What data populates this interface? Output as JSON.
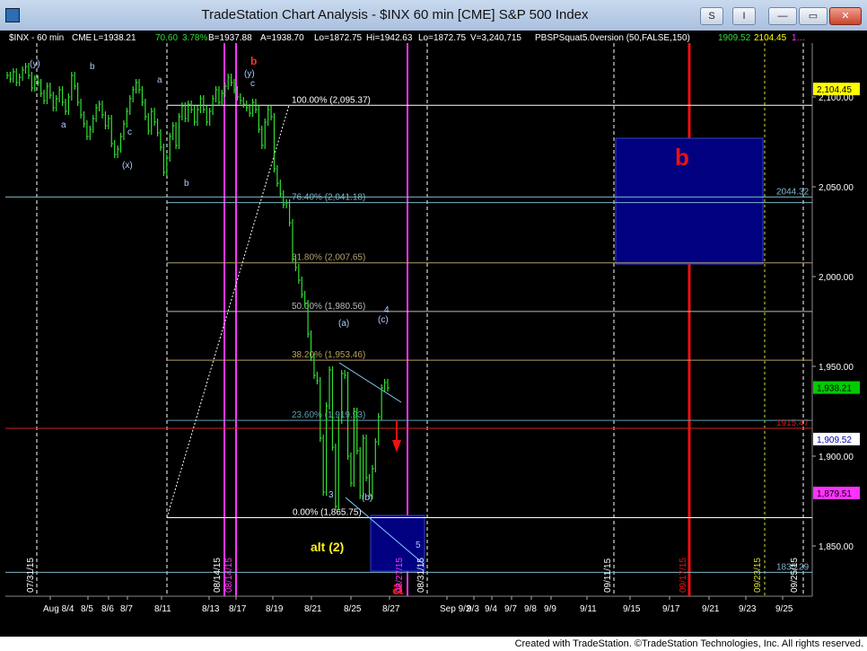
{
  "window": {
    "title": "TradeStation Chart Analysis - $INX 60 min [CME] S&P 500 Index",
    "buttons": {
      "s": "S",
      "indicator": "I",
      "minimize": "—",
      "maximize": "▭",
      "close": "✕"
    }
  },
  "chart_data": {
    "type": "line",
    "header": {
      "symbol": "$INX - 60 min",
      "exchange": "CME",
      "last": "L=1938.21",
      "change": "70.60",
      "pct": "3.78%",
      "bid": "B=1937.88",
      "ask": "A=1938.70",
      "low_day": "Lo=1872.75",
      "high_day": "Hi=1942.63",
      "low": "Lo=1872.75",
      "volume": "V=3,240,715",
      "indicator": "PBSPSquat5.0version (50,FALSE,150)",
      "ind_v1": "1909.52",
      "ind_v2": "2104.45",
      "ind_v3": "1…"
    },
    "colors": {
      "price": "#33dd33",
      "magenta": "#ff33ff",
      "red": "#ee1111",
      "white_line": "#ffffff",
      "box": "#000080"
    },
    "ylim": [
      1822,
      2130
    ],
    "y_ticks": [
      "2,100.00",
      "2,050.00",
      "2,000.00",
      "1,950.00",
      "1,900.00",
      "1,850.00"
    ],
    "y_tick_values": [
      2100,
      2050,
      2000,
      1950,
      1900,
      1850
    ],
    "price_tags": [
      {
        "label": "2,104.45",
        "value": 2104.45,
        "bg": "#ffff00",
        "fg": "#000000"
      },
      {
        "label": "1,938.21",
        "value": 1938.21,
        "bg": "#00cc00",
        "fg": "#000000"
      },
      {
        "label": "1,909.52",
        "value": 1909.52,
        "bg": "#ffffff",
        "fg": "#0000aa"
      },
      {
        "label": "1,879.51",
        "value": 1879.51,
        "bg": "#ff33ff",
        "fg": "#000000"
      }
    ],
    "x_ticks": [
      "Aug 8/4",
      "8/5",
      "8/6",
      "8/7",
      "8/11",
      "8/13",
      "8/17",
      "8/19",
      "8/21",
      "8/25",
      "8/27",
      "Sep 9/2",
      "9/3",
      "9/4",
      "9/7",
      "9/8",
      "9/9",
      "9/11",
      "9/15",
      "9/17",
      "9/21",
      "9/23",
      "9/25"
    ],
    "rotated_dates": [
      {
        "label": "07/31/15",
        "color": "#ffffff"
      },
      {
        "label": "08/14/15",
        "color": "#ffffff"
      },
      {
        "label": "08/14/15",
        "color": "#ff33ff"
      },
      {
        "label": "08/27/15",
        "color": "#ff33ff"
      },
      {
        "label": "08/31/15",
        "color": "#ffffff"
      },
      {
        "label": "09/11/15",
        "color": "#ffffff"
      },
      {
        "label": "09/17/15",
        "color": "#ee1111"
      },
      {
        "label": "09/23/15",
        "color": "#dddd33"
      },
      {
        "label": "09/25/15",
        "color": "#ffffff"
      }
    ],
    "fib_levels": [
      {
        "label": "100.00% (2,095.37)",
        "value": 2095.37,
        "color": "#ffffff"
      },
      {
        "label": "76.40% (2,041.18)",
        "value": 2041.18,
        "color": "#7fb6c8"
      },
      {
        "label": "61.80% (2,007.65)",
        "value": 2007.65,
        "color": "#b0a070"
      },
      {
        "label": "50.00% (1,980.56)",
        "value": 1980.56,
        "color": "#bbbbbb"
      },
      {
        "label": "38.20% (1,953.46)",
        "value": 1953.46,
        "color": "#b8a060"
      },
      {
        "label": "23.60% (1,919.93)",
        "value": 1919.93,
        "color": "#5aa0b0"
      },
      {
        "label": "0.00% (1,865.75)",
        "value": 1865.75,
        "color": "#ffffff"
      }
    ],
    "hlines": [
      {
        "label": "2044.32",
        "value": 2044.32,
        "color": "#7fb6c8"
      },
      {
        "label": "1915.47",
        "value": 1915.47,
        "color": "#cc2222"
      },
      {
        "label": "1835.29",
        "value": 1835.29,
        "color": "#7fb6c8"
      }
    ],
    "wave_labels": [
      {
        "text": "(y)",
        "color": "#aaccff"
      },
      {
        "text": "b",
        "color": "#aaccff"
      },
      {
        "text": "a",
        "color": "#aaccff"
      },
      {
        "text": "c",
        "color": "#aaccff"
      },
      {
        "text": "(x)",
        "color": "#aaccff"
      },
      {
        "text": "a",
        "color": "#aaccff"
      },
      {
        "text": "b",
        "color": "#aaccff"
      },
      {
        "text": "b",
        "color": "#ff3333"
      },
      {
        "text": "(y)",
        "color": "#aaccff"
      },
      {
        "text": "c",
        "color": "#aaccff"
      },
      {
        "text": "(a)",
        "color": "#aaccff"
      },
      {
        "text": "4",
        "color": "#aaccff"
      },
      {
        "text": "(c)",
        "color": "#aaccff"
      },
      {
        "text": "3",
        "color": "#aaccff"
      },
      {
        "text": "(b)",
        "color": "#aaccff"
      },
      {
        "text": "5",
        "color": "#aaccff"
      },
      {
        "text": "alt (2)",
        "color": "#ffee22"
      },
      {
        "text": "b",
        "color": "#ee1111"
      }
    ],
    "price_path": [
      [
        2112,
        2110,
        2114,
        2108,
        2111,
        2115,
        2117,
        2112,
        2105,
        2110
      ],
      [
        2108,
        2102,
        2098,
        2106,
        2101,
        2094,
        2099,
        2104,
        2097,
        2092
      ],
      [
        2100,
        2112,
        2106,
        2097,
        2090,
        2085,
        2078,
        2082,
        2088,
        2094
      ],
      [
        2096,
        2090,
        2084,
        2088,
        2074,
        2068,
        2071,
        2078,
        2085,
        2092
      ],
      [
        2099,
        2104,
        2108,
        2104,
        2097,
        2089,
        2081,
        2092,
        2086,
        2080
      ],
      [
        2072,
        2058,
        2066,
        2078,
        2084,
        2073,
        2089,
        2095,
        2088,
        2096
      ],
      [
        2093,
        2086,
        2093,
        2099,
        2093,
        2086,
        2092,
        2099,
        2104,
        2097
      ],
      [
        2102,
        2106,
        2111,
        2108,
        2104,
        2100,
        2098,
        2096,
        2094,
        2091
      ],
      [
        2097,
        2093,
        2082,
        2073,
        2086,
        2093,
        2089,
        2060,
        2052,
        2046
      ],
      [
        2040,
        2041,
        2030,
        2010,
        2005,
        1998,
        1990,
        1985,
        1968,
        1955
      ],
      [
        1945,
        1942,
        1910,
        1880,
        1928,
        1948,
        1905,
        1872,
        1920,
        1946
      ],
      [
        1945,
        1900,
        1885,
        1925,
        1903,
        1878,
        1910,
        1888,
        1878,
        1893
      ],
      [
        1908,
        1922,
        1938,
        1941,
        1938
      ]
    ]
  },
  "footer": "Created with TradeStation. ©TradeStation Technologies, Inc. All rights reserved."
}
